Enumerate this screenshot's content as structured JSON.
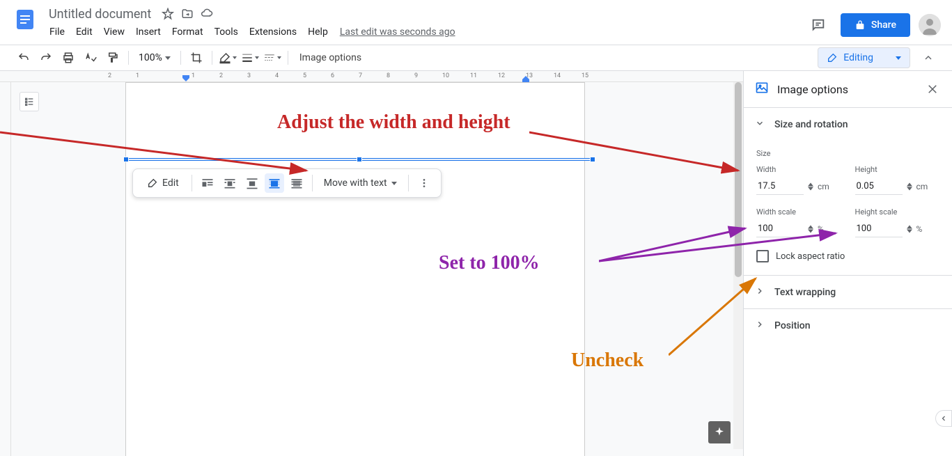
{
  "header": {
    "doc_title": "Untitled document",
    "menu": [
      "File",
      "Edit",
      "View",
      "Insert",
      "Format",
      "Tools",
      "Extensions",
      "Help"
    ],
    "last_edit": "Last edit was seconds ago",
    "share_label": "Share"
  },
  "toolbar": {
    "zoom": "100%",
    "image_options_label": "Image options",
    "editing_label": "Editing"
  },
  "float_toolbar": {
    "edit_label": "Edit",
    "move_label": "Move with text"
  },
  "sidebar": {
    "panel_title": "Image options",
    "sections": {
      "size_rotation": {
        "title": "Size and rotation",
        "subsection_size": "Size",
        "width_label": "Width",
        "width_value": "17.5",
        "width_unit": "cm",
        "height_label": "Height",
        "height_value": "0.05",
        "height_unit": "cm",
        "width_scale_label": "Width scale",
        "width_scale_value": "100",
        "width_scale_unit": "%",
        "height_scale_label": "Height scale",
        "height_scale_value": "100",
        "height_scale_unit": "%",
        "lock_aspect_label": "Lock aspect ratio"
      },
      "text_wrapping": {
        "title": "Text wrapping"
      },
      "position": {
        "title": "Position"
      }
    }
  },
  "ruler_ticks": [
    "2",
    "1",
    "",
    "1",
    "2",
    "3",
    "4",
    "5",
    "6",
    "7",
    "8",
    "9",
    "10",
    "11",
    "12",
    "13",
    "14",
    "15"
  ],
  "annotations": {
    "red_text": "Adjust the width and height",
    "purple_text": "Set to 100%",
    "orange_text": "Uncheck"
  }
}
